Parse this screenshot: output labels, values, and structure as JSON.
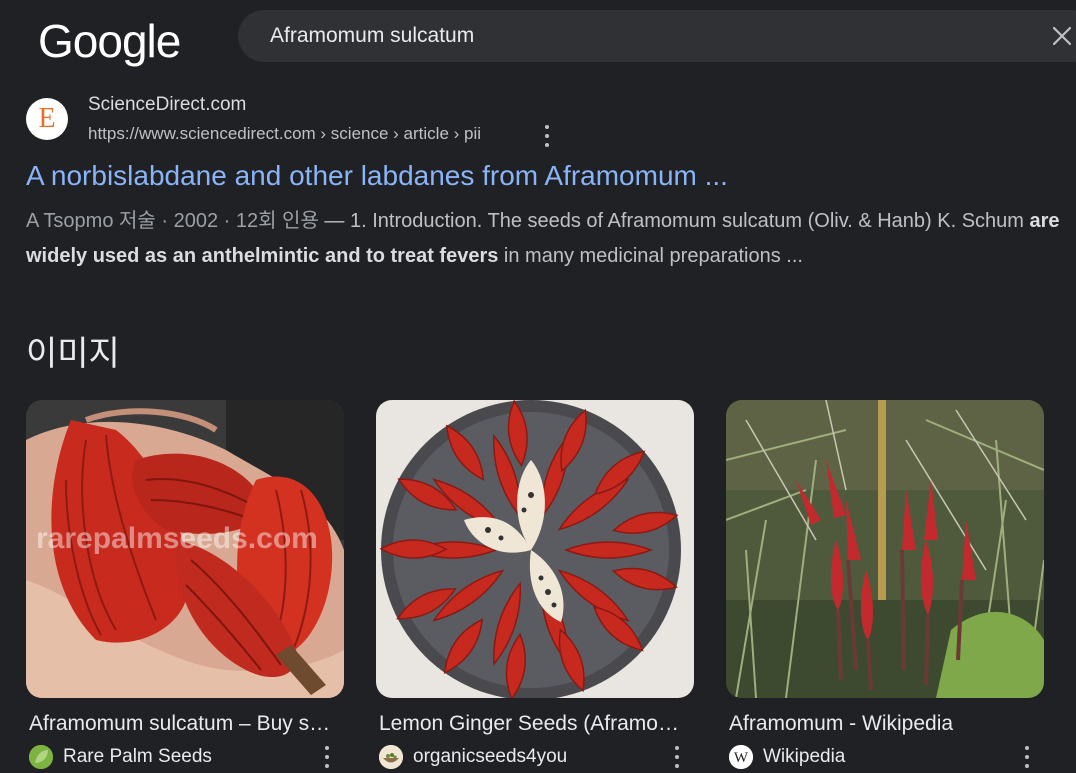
{
  "header": {
    "logo": "Google",
    "query": "Aframomum sulcatum"
  },
  "result": {
    "favicon_letter": "E",
    "site_name": "ScienceDirect.com",
    "url": "https://www.sciencedirect.com › science › article › pii",
    "title": "A norbislabdane and other labdanes from Aframomum ...",
    "snippet_meta": "A Tsopmo 저술 · 2002 · 12회 인용",
    "snippet_part1": " — 1. Introduction. The seeds of Aframomum sulcatum (Oliv. & Hanb) K. Schum ",
    "snippet_bold": "are widely used as an anthelmintic and to treat fevers",
    "snippet_part2": " in many medicinal preparations ..."
  },
  "images_section": {
    "title": "이미지",
    "cards": [
      {
        "title": "Aframomum sulcatum – Buy seeds at rarepalmseeds.com",
        "source": "Rare Palm Seeds",
        "source_icon": "green-leaf-icon",
        "watermark": "rarepalmseeds.com"
      },
      {
        "title": "Lemon Ginger Seeds (Aframomum sulcatum)",
        "source": "organicseeds4you",
        "source_icon": "seed-bowl-icon"
      },
      {
        "title": "Aframomum - Wikipedia",
        "source": "Wikipedia",
        "source_icon": "wikipedia-w-icon",
        "source_icon_letter": "W"
      }
    ]
  },
  "colors": {
    "background": "#202124",
    "link": "#8ab4f8",
    "fruit_red": "#c8291f"
  }
}
